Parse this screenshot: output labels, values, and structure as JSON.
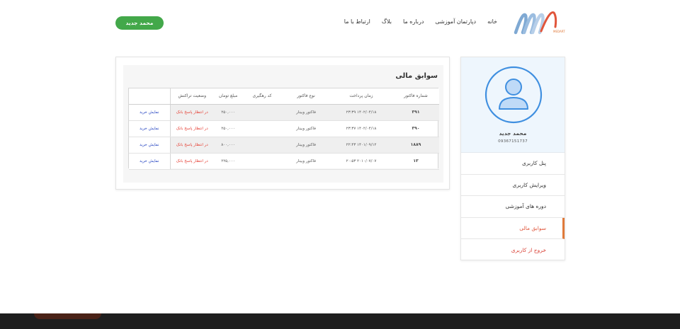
{
  "header": {
    "logo_text": "MEDART",
    "nav": [
      "خانه",
      "دپارتمان آموزشی",
      "درباره ما",
      "بلاگ",
      "ارتباط با ما"
    ],
    "user_button": "محمد جدید"
  },
  "sidebar": {
    "name": "محمد جدید",
    "phone": "09367151737",
    "menu": [
      "پنل کاربری",
      "ویرایش کاربری",
      "دوره های آموزشی",
      "سوابق مالی",
      "خروج از کاربری"
    ],
    "active_index": 3
  },
  "financial": {
    "title": "سوابق مالی",
    "columns": [
      "شماره فاکتور",
      "زمان پرداخت",
      "نوع فاکتور",
      "کد رهگیری",
      "مبلغ تومان",
      "وضعیت تراکنش",
      ""
    ],
    "rows": [
      {
        "invoice": "۳۹۱",
        "time": "۱۴۰۲/۰۴/۱۸ ۲۳:۳۹",
        "type": "فاکتور وبینار",
        "tracking": "",
        "amount": "۲۵۰,۰۰۰",
        "status": "در انتظار پاسخ بانک",
        "action": "نمایش خرید"
      },
      {
        "invoice": "۳۹۰",
        "time": "۱۴۰۲/۰۴/۱۸ ۲۳:۳۷",
        "type": "فاکتور وبینار",
        "tracking": "",
        "amount": "۲۵۰,۰۰۰",
        "status": "در انتظار پاسخ بانک",
        "action": "نمایش خرید"
      },
      {
        "invoice": "۱۸۸۹",
        "time": "۱۴۰۱/۰۹/۱۲ ۲۲:۴۳",
        "type": "فاکتور وبینار",
        "tracking": "",
        "amount": "۸۰۰,۰۰۰",
        "status": "در انتظار پاسخ بانک",
        "action": "نمایش خرید"
      },
      {
        "invoice": "۱۳",
        "time": "۲۰۱۰/۰۷/۰۷ ۲۰:۵۳",
        "type": "فاکتور وبینار",
        "tracking": "",
        "amount": "۲۲۵,۰۰۰",
        "status": "در انتظار پاسخ بانک",
        "action": "نمایش خرید"
      }
    ]
  },
  "colors": {
    "accent_green": "#43a84a",
    "accent_orange": "#e07a3a",
    "status_red": "#e53a2f",
    "link_blue": "#1f3fbf",
    "avatar_blue": "#3f8fe0"
  }
}
